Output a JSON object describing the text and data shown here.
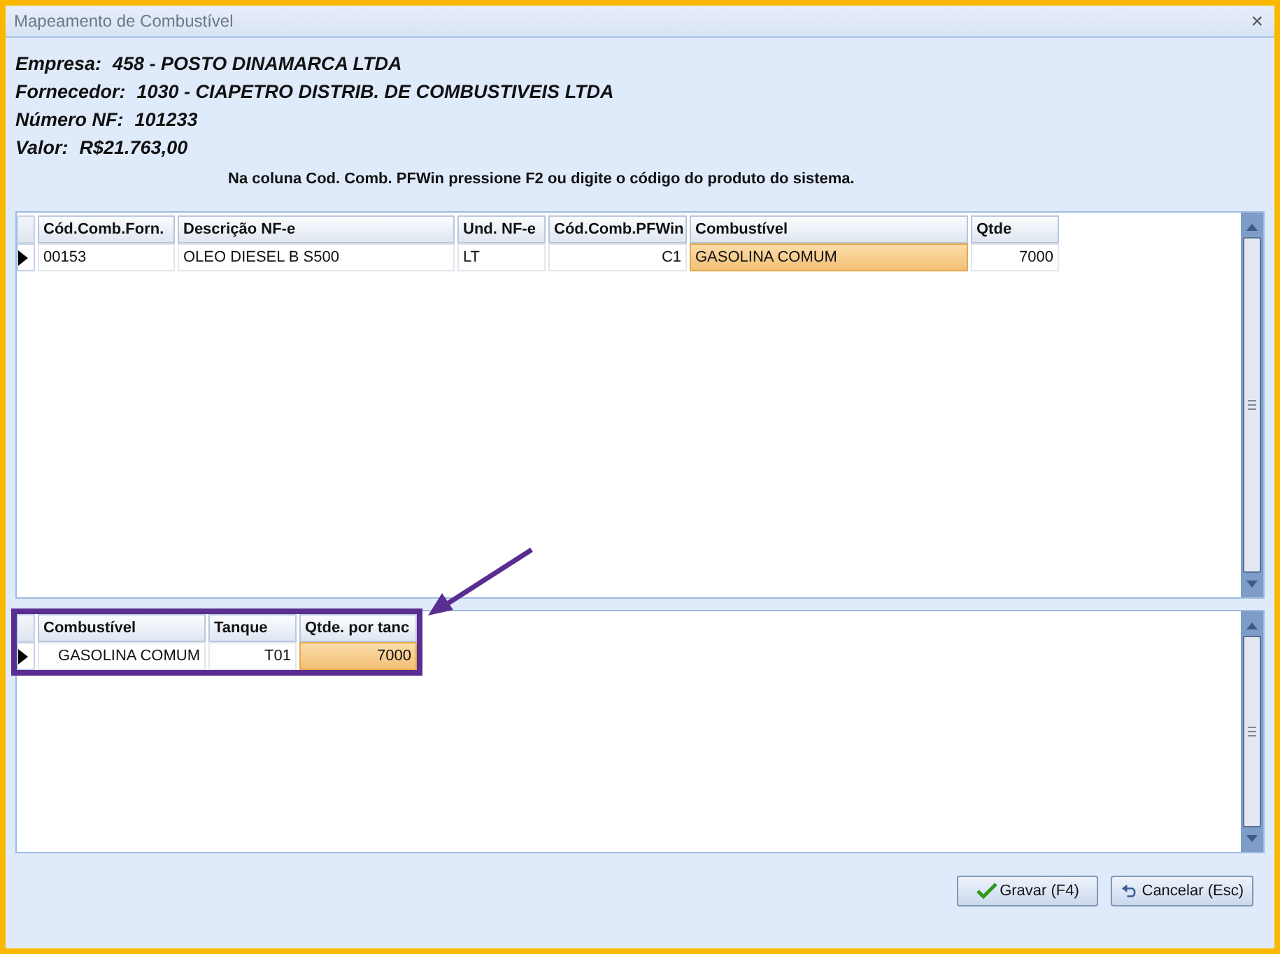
{
  "window": {
    "title": "Mapeamento de Combustível",
    "close": "×"
  },
  "info": [
    {
      "label": "Empresa:",
      "value": "458 - POSTO DINAMARCA LTDA"
    },
    {
      "label": "Fornecedor:",
      "value": "1030 - CIAPETRO DISTRIB. DE COMBUSTIVEIS LTDA"
    },
    {
      "label": "Número NF:",
      "value": "101233"
    },
    {
      "label": "Valor:",
      "value": "R$21.763,00"
    }
  ],
  "instruction": "Na coluna Cod. Comb. PFWin pressione F2 ou digite o código do produto do sistema.",
  "items_table": {
    "columns": [
      "Cód.Comb.Forn.",
      "Descrição NF-e",
      "Und. NF-e",
      "Cód.Comb.PFWin",
      "Combustível",
      "Qtde"
    ],
    "rows": [
      {
        "current": true,
        "cells": [
          {
            "text": "00153",
            "selected": false
          },
          {
            "text": "OLEO DIESEL  B  S500",
            "selected": false
          },
          {
            "text": "LT",
            "selected": false
          },
          {
            "text": "C1",
            "selected": false
          },
          {
            "text": "GASOLINA COMUM",
            "selected": true
          },
          {
            "text": "7000",
            "selected": false
          }
        ]
      }
    ]
  },
  "tanks_table": {
    "highlighted": true,
    "columns": [
      "Combustível",
      "Tanque",
      "Qtde. por tanc"
    ],
    "rows": [
      {
        "current": true,
        "cells": [
          {
            "text": "GASOLINA COMUM",
            "selected": false
          },
          {
            "text": "T01",
            "selected": false
          },
          {
            "text": "7000",
            "selected": true
          }
        ]
      }
    ]
  },
  "buttons": [
    {
      "kind": "save",
      "label": "Gravar (F4)"
    },
    {
      "kind": "cancel",
      "label": "Cancelar (Esc)"
    }
  ]
}
